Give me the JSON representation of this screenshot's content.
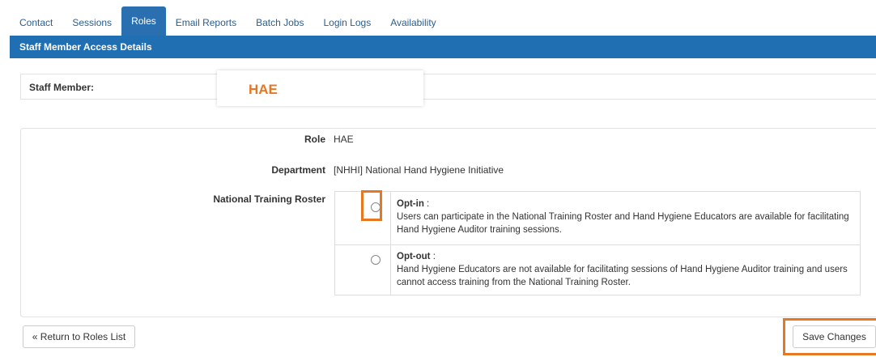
{
  "tabs": [
    {
      "label": "Contact"
    },
    {
      "label": "Sessions"
    },
    {
      "label": "Roles",
      "active": true
    },
    {
      "label": "Email Reports"
    },
    {
      "label": "Batch Jobs"
    },
    {
      "label": "Login Logs"
    },
    {
      "label": "Availability"
    }
  ],
  "panel": {
    "title": "Staff Member Access Details"
  },
  "staff": {
    "label": "Staff Member:",
    "value": "HAE"
  },
  "form": {
    "role_label": "Role",
    "role_value": "HAE",
    "department_label": "Department",
    "department_value": "[NHHI] National Hand Hygiene Initiative",
    "roster_label": "National Training Roster",
    "options": [
      {
        "title": "Opt-in",
        "suffix": " :",
        "description": "Users can participate in the National Training Roster and Hand Hygiene Educators are available for facilitating Hand Hygiene Auditor training sessions.",
        "selected": false
      },
      {
        "title": "Opt-out",
        "suffix": " :",
        "description": "Hand Hygiene Educators are not available for facilitating sessions of Hand Hygiene Auditor training and users cannot access training from the National Training Roster.",
        "selected": false
      }
    ]
  },
  "buttons": {
    "return_label": "« Return to Roles List",
    "save_label": "Save Changes"
  },
  "colors": {
    "accent": "#1f6fb2",
    "highlight": "#e87722"
  }
}
